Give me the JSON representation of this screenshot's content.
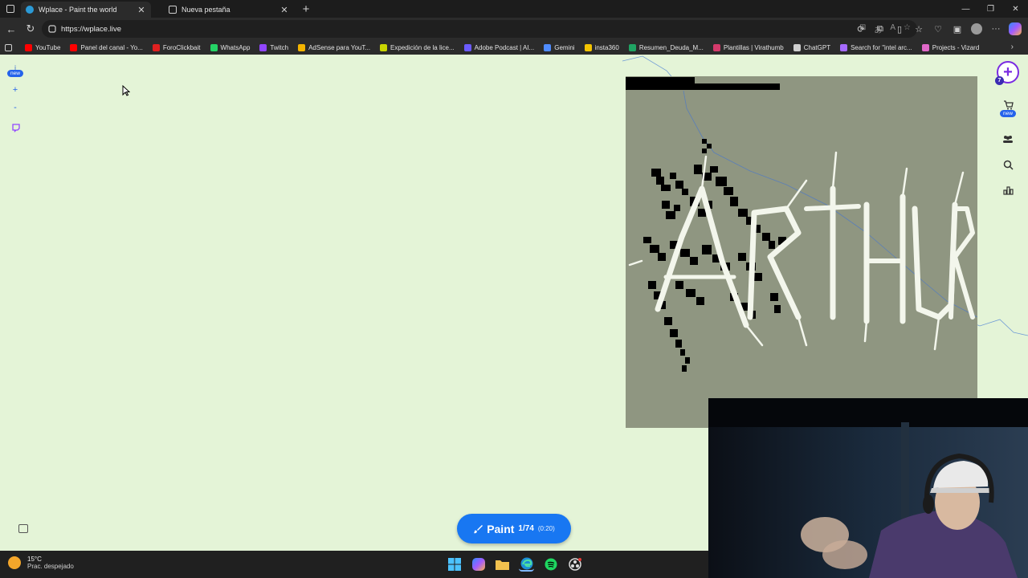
{
  "browser": {
    "tabs": [
      {
        "title": "Wplace - Paint the world",
        "active": true,
        "favicon": "globe-icon"
      },
      {
        "title": "Nueva pestaña",
        "active": false,
        "favicon": "page-icon"
      }
    ],
    "url": "https://wplace.live",
    "bookmarks": [
      {
        "label": "YouTube",
        "color": "#ff0000"
      },
      {
        "label": "Panel del canal - Yo...",
        "color": "#ff0000"
      },
      {
        "label": "ForoClickbait",
        "color": "#e02020"
      },
      {
        "label": "WhatsApp",
        "color": "#25d366"
      },
      {
        "label": "Twitch",
        "color": "#9146ff"
      },
      {
        "label": "AdSense para YouT...",
        "color": "#f4b400"
      },
      {
        "label": "Expedición de la lice...",
        "color": "#c8d400"
      },
      {
        "label": "Adobe Podcast | AI...",
        "color": "#6b5bff"
      },
      {
        "label": "Gemini",
        "color": "#4f8cff"
      },
      {
        "label": "insta360",
        "color": "#f4c400"
      },
      {
        "label": "Resumen_Deuda_M...",
        "color": "#1fa463"
      },
      {
        "label": "Plantillas | Virathumb",
        "color": "#d43a6b"
      },
      {
        "label": "ChatGPT",
        "color": "#cfcfcf"
      },
      {
        "label": "Search for \"intel arc...",
        "color": "#a66bff"
      },
      {
        "label": "Projects - Vizard",
        "color": "#e068c8"
      }
    ]
  },
  "app": {
    "left_rail": {
      "info_label": "i",
      "new_badge": "new",
      "zoom_in": "+",
      "zoom_out": "-"
    },
    "right_rail": {
      "plus_count": "7",
      "store_new_badge": "new"
    },
    "artwork_text": "ARTHUR",
    "paint_button": {
      "label": "Paint",
      "count": "1/74",
      "timer": "(0:20)"
    },
    "accent_color": "#1877f2"
  },
  "taskbar": {
    "temperature": "15°C",
    "weather_desc": "Prac. despejado"
  }
}
